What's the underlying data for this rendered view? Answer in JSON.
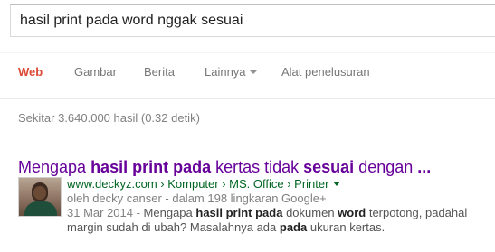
{
  "search": {
    "query": "hasil print pada word nggak sesuai"
  },
  "tabs": [
    {
      "label": "Web",
      "active": true
    },
    {
      "label": "Gambar"
    },
    {
      "label": "Berita"
    },
    {
      "label": "Lainnya",
      "dropdown": true
    },
    {
      "label": "Alat penelusuran"
    }
  ],
  "stats": "Sekitar 3.640.000 hasil (0.32 detik)",
  "result": {
    "title": {
      "p1": "Mengapa ",
      "b1": "hasil print pada",
      "p2": " kertas tidak ",
      "b2": "sesuai",
      "p3": " dengan ",
      "b3": "..."
    },
    "url": "www.deckyz.com › Komputer › MS. Office › Printer",
    "author": {
      "prefix": "oleh ",
      "name": "decky canser",
      "suffix": " - dalam 198 lingkaran Google+"
    },
    "snippet": {
      "date": "31 Mar 2014 - ",
      "t1": "Mengapa ",
      "b1": "hasil print pada",
      "t2": " dokumen ",
      "b2": "word",
      "t3": " terpotong, padahal margin sudah di ubah? Masalahnya ada ",
      "b3": "pada",
      "t4": " ukuran kertas."
    }
  },
  "colors": {
    "active_tab": "#dd4b39",
    "title_visited": "#660099",
    "url_green": "#006621"
  },
  "icons": {
    "dropdown": "caret-down",
    "url_menu": "caret-down"
  }
}
